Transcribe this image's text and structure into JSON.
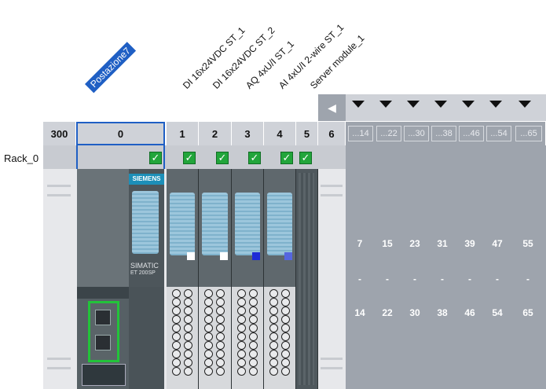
{
  "station_label": "Postazione7",
  "modules": [
    "DI 16x24VDC ST_1",
    "DI 16x24VDC ST_2",
    "AQ 4xU/I ST_1",
    "AI 4xU/I 2-wire ST_1",
    "Server module_1"
  ],
  "rack_label": "Rack_0",
  "slots": [
    "300",
    "0",
    "1",
    "2",
    "3",
    "4",
    "5",
    "6"
  ],
  "ranges_header": [
    "...14",
    "...22",
    "...30",
    "...38",
    "...46",
    "...54",
    "...65"
  ],
  "ranges_start": [
    "7",
    "15",
    "23",
    "31",
    "39",
    "47",
    "55"
  ],
  "ranges_dash": "-",
  "ranges_end": [
    "14",
    "22",
    "30",
    "38",
    "46",
    "54",
    "65"
  ],
  "head_module": {
    "brand": "SIEMENS",
    "model_line1": "SIMATIC",
    "model_line2": "ET 200SP"
  },
  "icons": {
    "scroll_left": "chevron-left-icon",
    "expand": "triangle-down-icon",
    "checked": "checkmark-icon"
  },
  "colors": {
    "selection": "#1f5fc4",
    "check": "#22a53b",
    "header_gray": "#cfd2d8",
    "dark_gray": "#9ea4ad"
  }
}
